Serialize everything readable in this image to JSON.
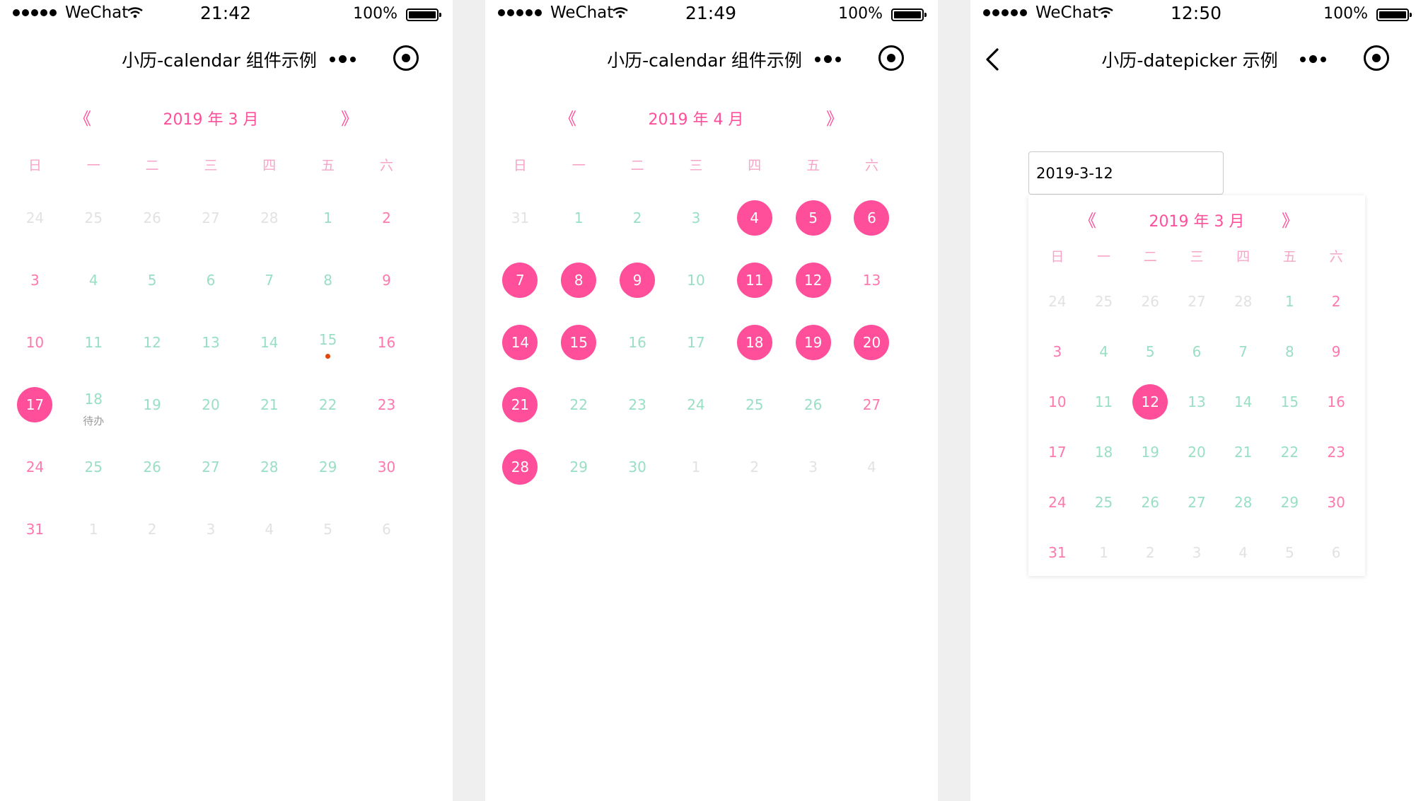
{
  "panels": [
    {
      "status": {
        "carrier": "WeChat",
        "time": "21:42",
        "battery": "100%"
      },
      "nav": {
        "title": "小历-calendar 组件示例",
        "show_back": false
      },
      "calendar": {
        "prev": "《",
        "next": "》",
        "title": "2019 年 3 月",
        "weekdays": [
          "日",
          "一",
          "二",
          "三",
          "四",
          "五",
          "六"
        ],
        "weeks": [
          [
            {
              "d": "24",
              "o": true
            },
            {
              "d": "25",
              "o": true
            },
            {
              "d": "26",
              "o": true
            },
            {
              "d": "27",
              "o": true
            },
            {
              "d": "28",
              "o": true
            },
            {
              "d": "1"
            },
            {
              "d": "2"
            }
          ],
          [
            {
              "d": "3"
            },
            {
              "d": "4"
            },
            {
              "d": "5"
            },
            {
              "d": "6"
            },
            {
              "d": "7"
            },
            {
              "d": "8"
            },
            {
              "d": "9"
            }
          ],
          [
            {
              "d": "10"
            },
            {
              "d": "11"
            },
            {
              "d": "12"
            },
            {
              "d": "13"
            },
            {
              "d": "14"
            },
            {
              "d": "15",
              "dot": true
            },
            {
              "d": "16"
            }
          ],
          [
            {
              "d": "17",
              "s": true
            },
            {
              "d": "18",
              "todo": "待办"
            },
            {
              "d": "19"
            },
            {
              "d": "20"
            },
            {
              "d": "21"
            },
            {
              "d": "22"
            },
            {
              "d": "23"
            }
          ],
          [
            {
              "d": "24"
            },
            {
              "d": "25"
            },
            {
              "d": "26"
            },
            {
              "d": "27"
            },
            {
              "d": "28"
            },
            {
              "d": "29"
            },
            {
              "d": "30"
            }
          ],
          [
            {
              "d": "31"
            },
            {
              "d": "1",
              "o": true
            },
            {
              "d": "2",
              "o": true
            },
            {
              "d": "3",
              "o": true
            },
            {
              "d": "4",
              "o": true
            },
            {
              "d": "5",
              "o": true
            },
            {
              "d": "6",
              "o": true
            }
          ]
        ]
      }
    },
    {
      "status": {
        "carrier": "WeChat",
        "time": "21:49",
        "battery": "100%"
      },
      "nav": {
        "title": "小历-calendar 组件示例",
        "show_back": false
      },
      "calendar": {
        "prev": "《",
        "next": "》",
        "title": "2019 年 4 月",
        "weekdays": [
          "日",
          "一",
          "二",
          "三",
          "四",
          "五",
          "六"
        ],
        "weeks": [
          [
            {
              "d": "31",
              "o": true
            },
            {
              "d": "1"
            },
            {
              "d": "2"
            },
            {
              "d": "3"
            },
            {
              "d": "4",
              "s": true
            },
            {
              "d": "5",
              "s": true
            },
            {
              "d": "6",
              "s": true
            }
          ],
          [
            {
              "d": "7",
              "s": true
            },
            {
              "d": "8",
              "s": true
            },
            {
              "d": "9",
              "s": true
            },
            {
              "d": "10"
            },
            {
              "d": "11",
              "s": true
            },
            {
              "d": "12",
              "s": true
            },
            {
              "d": "13"
            }
          ],
          [
            {
              "d": "14",
              "s": true
            },
            {
              "d": "15",
              "s": true
            },
            {
              "d": "16"
            },
            {
              "d": "17"
            },
            {
              "d": "18",
              "s": true
            },
            {
              "d": "19",
              "s": true
            },
            {
              "d": "20",
              "s": true
            }
          ],
          [
            {
              "d": "21",
              "s": true
            },
            {
              "d": "22"
            },
            {
              "d": "23"
            },
            {
              "d": "24"
            },
            {
              "d": "25"
            },
            {
              "d": "26"
            },
            {
              "d": "27"
            }
          ],
          [
            {
              "d": "28",
              "s": true
            },
            {
              "d": "29"
            },
            {
              "d": "30"
            },
            {
              "d": "1",
              "o": true
            },
            {
              "d": "2",
              "o": true
            },
            {
              "d": "3",
              "o": true
            },
            {
              "d": "4",
              "o": true
            }
          ]
        ]
      }
    },
    {
      "status": {
        "carrier": "WeChat",
        "time": "12:50",
        "battery": "100%"
      },
      "nav": {
        "title": "小历-datepicker 示例",
        "show_back": true
      },
      "input_value": "2019-3-12",
      "calendar": {
        "prev": "《",
        "next": "》",
        "title": "2019 年 3 月",
        "weekdays": [
          "日",
          "一",
          "二",
          "三",
          "四",
          "五",
          "六"
        ],
        "weeks": [
          [
            {
              "d": "24",
              "o": true
            },
            {
              "d": "25",
              "o": true
            },
            {
              "d": "26",
              "o": true
            },
            {
              "d": "27",
              "o": true
            },
            {
              "d": "28",
              "o": true
            },
            {
              "d": "1"
            },
            {
              "d": "2"
            }
          ],
          [
            {
              "d": "3"
            },
            {
              "d": "4"
            },
            {
              "d": "5"
            },
            {
              "d": "6"
            },
            {
              "d": "7"
            },
            {
              "d": "8"
            },
            {
              "d": "9"
            }
          ],
          [
            {
              "d": "10"
            },
            {
              "d": "11"
            },
            {
              "d": "12",
              "s": true
            },
            {
              "d": "13"
            },
            {
              "d": "14"
            },
            {
              "d": "15"
            },
            {
              "d": "16"
            }
          ],
          [
            {
              "d": "17"
            },
            {
              "d": "18"
            },
            {
              "d": "19"
            },
            {
              "d": "20"
            },
            {
              "d": "21"
            },
            {
              "d": "22"
            },
            {
              "d": "23"
            }
          ],
          [
            {
              "d": "24"
            },
            {
              "d": "25"
            },
            {
              "d": "26"
            },
            {
              "d": "27"
            },
            {
              "d": "28"
            },
            {
              "d": "29"
            },
            {
              "d": "30"
            }
          ],
          [
            {
              "d": "31"
            },
            {
              "d": "1",
              "o": true
            },
            {
              "d": "2",
              "o": true
            },
            {
              "d": "3",
              "o": true
            },
            {
              "d": "4",
              "o": true
            },
            {
              "d": "5",
              "o": true
            },
            {
              "d": "6",
              "o": true
            }
          ]
        ]
      }
    }
  ],
  "colors": {
    "accent": "#ff4f9a",
    "weekday_text": "#98dfc4",
    "weekend_text": "#ff78ad",
    "other_month_text": "#e2e2e2",
    "event_dot": "#e8450a",
    "gap": "#efefef"
  }
}
